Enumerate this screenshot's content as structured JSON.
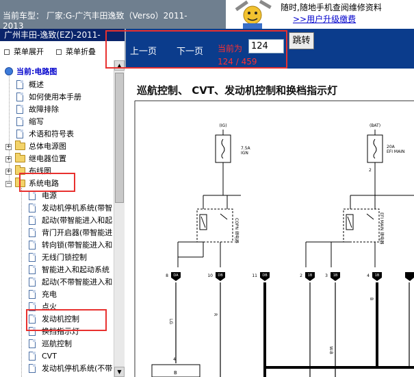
{
  "header": {
    "car_line1": "当前车型：  厂家:G-广汽丰田逸致（Verso）2011-",
    "car_line2": "2013",
    "promo_line1": "随时,随地手机查阅维修资料",
    "promo_line2": ">>用户升级缴费"
  },
  "sidebar": {
    "title": "广州丰田-逸致(EZ)-2011-",
    "expand_label": "菜单展开",
    "collapse_label": "菜单折叠",
    "current_label": "当前:电路图",
    "items": [
      {
        "label": "概述",
        "type": "doc"
      },
      {
        "label": "如何使用本手册",
        "type": "doc"
      },
      {
        "label": "故障排除",
        "type": "doc"
      },
      {
        "label": "缩写",
        "type": "doc"
      },
      {
        "label": "术语和符号表",
        "type": "doc"
      },
      {
        "label": "总体电源图",
        "type": "folder"
      },
      {
        "label": "继电器位置",
        "type": "folder"
      },
      {
        "label": "布线图",
        "type": "folder"
      },
      {
        "label": "系统电路",
        "type": "folder-open"
      }
    ],
    "sub_items": [
      "电源",
      "发动机停机系统(带智",
      "起动(带智能进入和起",
      "背门开启器(带智能进",
      "转向锁(带智能进入和",
      "无线门锁控制",
      "智能进入和起动系统",
      "起动(不带智能进入和",
      "充电",
      "点火",
      "发动机控制",
      "换挡指示灯",
      "巡航控制",
      "CVT",
      "发动机停机系统(不带"
    ]
  },
  "toolbar": {
    "prev_label": "上一页",
    "next_label": "下一页",
    "page_label": "当前为",
    "page_value": "124",
    "page_count": "124 / 459",
    "go_label": "跳转"
  },
  "diagram": {
    "title": "巡航控制、 CVT、发动机控制和换档指示灯",
    "fuse1_top": "(IG)",
    "fuse1_rating": "7.5A",
    "fuse1_name": "IGN",
    "fuse2_top": "(BAT)",
    "fuse2_rating": "20A",
    "fuse2_name": "EFI MAIN",
    "relay1_label": "COPN 继电器",
    "relay2_label": "EFI MAIN 继电器",
    "pin_2": "2",
    "connectors": [
      {
        "num": "8",
        "code": "DA"
      },
      {
        "num": "10",
        "code": "DB"
      },
      {
        "num": "11",
        "code": "DB"
      },
      {
        "num": "2",
        "code": "1B"
      },
      {
        "num": "3",
        "code": "1B"
      },
      {
        "num": "4",
        "code": "1B"
      }
    ],
    "wire_lg": "LG",
    "wire_r": "R",
    "wire_b": "B",
    "wire_wb": "W-B",
    "pin_4": "4",
    "bottom_b": "B"
  },
  "colors": {
    "toolbar_bg": "#0b3c8c",
    "sidebar_head_bg": "#0a246a",
    "highlight_red": "#e8302e",
    "header_gray": "#6f7f8f"
  }
}
